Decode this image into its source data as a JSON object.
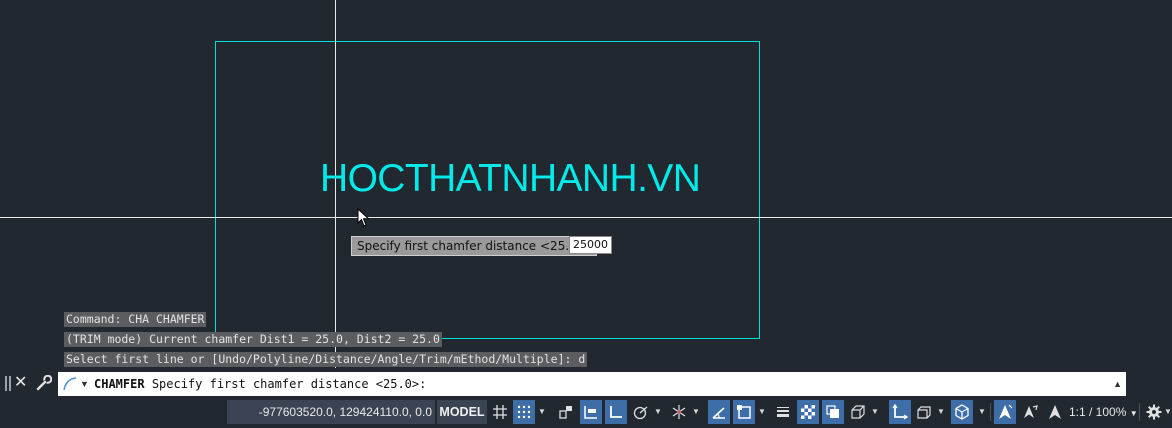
{
  "drawing": {
    "text": "HOCTHATNHANH.VN",
    "colors": {
      "background": "#212830",
      "geometry": "#00dede",
      "crosshair": "#e9e9e9"
    }
  },
  "tooltip": {
    "prompt": "Specify first chamfer distance <25.0>:",
    "value": "25000"
  },
  "history": [
    "Command: CHA CHAMFER",
    "(TRIM mode) Current chamfer Dist1 = 25.0, Dist2 = 25.0",
    "Select first line or [Undo/Polyline/Distance/Angle/Trim/mEthod/Multiple]: d"
  ],
  "command_line": {
    "command": "CHAMFER",
    "prompt": "Specify first chamfer distance <25.0>:"
  },
  "status_bar": {
    "coordinates": "-977603520.0, 129424110.0, 0.0",
    "model_label": "MODEL",
    "scale_label": "1:1 / 100%",
    "icons": [
      "grid-icon",
      "snap-icon",
      "ortho-icon",
      "polar-icon",
      "isodraft-icon",
      "osnap-icon",
      "object-snap-tracking-icon",
      "lineweight-icon",
      "transparency-icon",
      "selection-cycling-icon",
      "3d-osnap-icon",
      "dynamic-ucs-icon",
      "selection-filter-icon",
      "gizmo-icon",
      "annotation-visibility-icon",
      "autoscale-icon",
      "annotation-scale-icon",
      "settings-icon"
    ]
  }
}
